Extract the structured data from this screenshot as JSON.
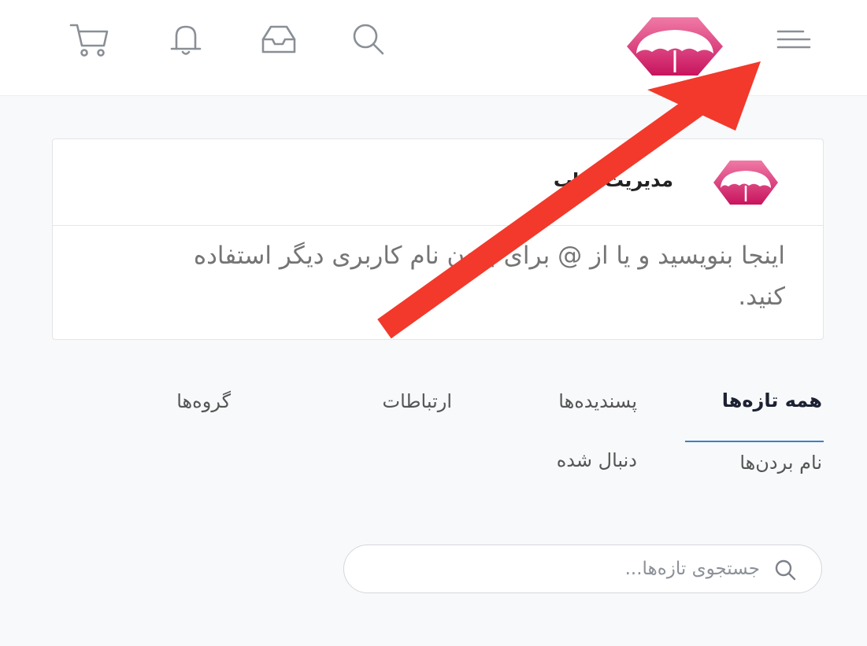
{
  "header": {
    "icons": [
      "menu-icon",
      "umbrella-logo",
      "search-icon",
      "inbox-icon",
      "bell-icon",
      "cart-icon"
    ],
    "accent_color": "#e0307a"
  },
  "composer": {
    "author_name": "مدیریت شاب",
    "placeholder": "اینجا بنویسید و یا از @ برای بردن نام کاربری دیگر استفاده کنید."
  },
  "tabs": {
    "all_feeds": "همه تازه‌ها",
    "liked": "پسندیده‌ها",
    "connections": "ارتباطات",
    "groups": "گروه‌ها",
    "mentions": "نام بردن‌ها",
    "followed": "دنبال شده",
    "active_color": "#3b82c4"
  },
  "search": {
    "placeholder": "جستجوی تازه‌ها..."
  },
  "annotation": {
    "arrow_color": "#f2392b"
  }
}
